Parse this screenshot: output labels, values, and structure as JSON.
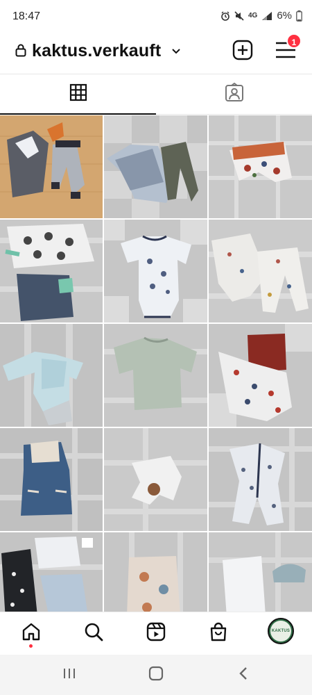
{
  "status_bar": {
    "time": "18:47",
    "network": "4G",
    "battery": "6%",
    "icons": [
      "alarm-icon",
      "mute-icon",
      "signal-icon",
      "battery-icon"
    ]
  },
  "header": {
    "username": "kaktus.verkauft",
    "notification_count": "1",
    "icons": [
      "lock-icon",
      "chevron-down-icon",
      "add-post-icon",
      "menu-icon"
    ]
  },
  "tabs": [
    {
      "name": "grid",
      "icon": "grid-icon",
      "active": true
    },
    {
      "name": "tagged",
      "icon": "tagged-icon",
      "active": false
    }
  ],
  "posts": [
    {
      "description": "hoodie set with orange scarf and pants"
    },
    {
      "description": "tractor print shirt with grey pants"
    },
    {
      "description": "orange waistband print pants"
    },
    {
      "description": "print bodysuits with green cuffs"
    },
    {
      "description": "short sleeve print bodysuit"
    },
    {
      "description": "hoodie and pants set with print"
    },
    {
      "description": "long sleeve light blue bodysuit"
    },
    {
      "description": "sage green long sleeve shirt"
    },
    {
      "description": "red shorts with print sleeper"
    },
    {
      "description": "denim hooded vest"
    },
    {
      "description": "white scarf with bear"
    },
    {
      "description": "print sleeper with navy trim"
    },
    {
      "description": "clothing bundle"
    },
    {
      "description": "print romper"
    },
    {
      "description": "white pants and blue hat"
    }
  ],
  "bottom_nav": {
    "items": [
      "home-icon",
      "search-icon",
      "reels-icon",
      "shop-icon"
    ],
    "avatar_text": "KAKTUS"
  },
  "colors": {
    "accent": "#ff3040",
    "avatar_green": "#2f6d46",
    "mat_grey": "#b9b9b9"
  }
}
